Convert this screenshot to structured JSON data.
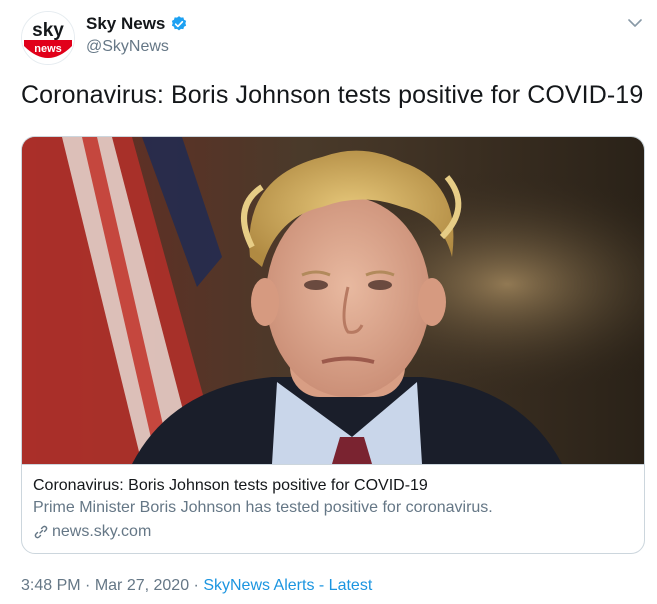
{
  "author": {
    "logo_top": "sky",
    "logo_bottom": "news",
    "display_name": "Sky News",
    "handle": "@SkyNews"
  },
  "tweet": {
    "text": "Coronavirus: Boris Johnson tests positive for COVID-19"
  },
  "card": {
    "title": "Coronavirus: Boris Johnson tests positive for COVID-19",
    "description": "Prime Minister Boris Johnson has tested positive for coronavirus.",
    "domain": "news.sky.com"
  },
  "meta": {
    "time": "3:48 PM",
    "separator1": " · ",
    "date": "Mar 27, 2020",
    "separator2": " · ",
    "source": "SkyNews Alerts - Latest"
  },
  "colors": {
    "brand_red": "#e1001a",
    "verified_blue": "#1da1f2",
    "link_blue": "#1b95e0",
    "secondary_text": "#657786"
  },
  "icons": {
    "verified": "verified-badge-icon",
    "menu": "chevron-down-icon",
    "link": "link-icon"
  }
}
